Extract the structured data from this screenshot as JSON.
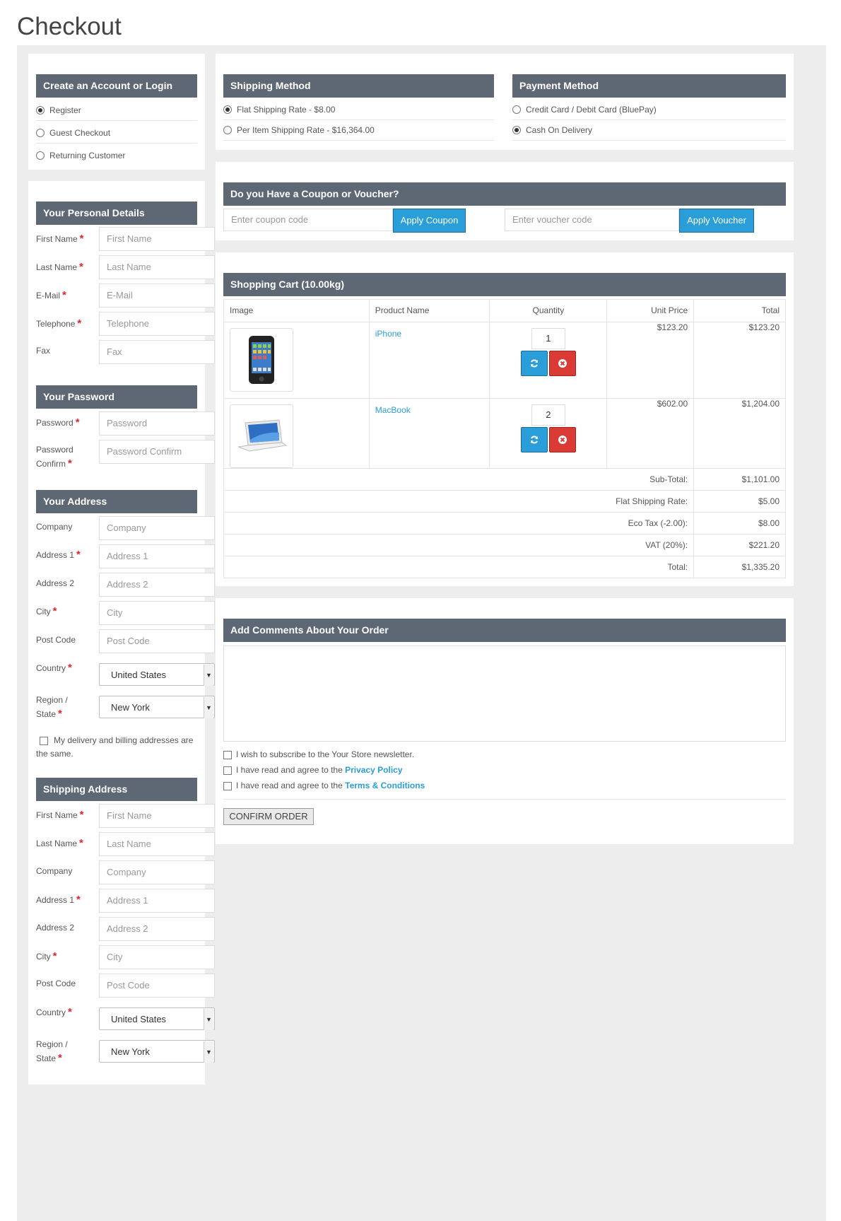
{
  "page": {
    "title": "Checkout"
  },
  "account": {
    "title": "Create an Account or Login",
    "options": [
      {
        "label": "Register",
        "checked": true
      },
      {
        "label": "Guest Checkout",
        "checked": false
      },
      {
        "label": "Returning Customer",
        "checked": false
      }
    ]
  },
  "personal": {
    "title": "Your Personal Details",
    "fields": [
      {
        "label": "First Name",
        "required": "*",
        "placeholder": "First Name"
      },
      {
        "label": "Last Name",
        "required": "*",
        "placeholder": "Last Name"
      },
      {
        "label": "E-Mail",
        "required": "*",
        "placeholder": "E-Mail"
      },
      {
        "label": "Telephone",
        "required": "*",
        "placeholder": "Telephone"
      },
      {
        "label": "Fax",
        "required": "",
        "placeholder": "Fax"
      }
    ]
  },
  "password": {
    "title": "Your Password",
    "password_label": "Password",
    "password_required": "*",
    "password_placeholder": "Password",
    "confirm_label_line1": "Password",
    "confirm_label_line2": "Confirm",
    "confirm_required": "*",
    "confirm_placeholder": "Password Confirm"
  },
  "address": {
    "title": "Your Address",
    "fields": [
      {
        "label": "Company",
        "required": "",
        "placeholder": "Company"
      },
      {
        "label": "Address 1",
        "required": "*",
        "placeholder": "Address 1"
      },
      {
        "label": "Address 2",
        "required": "",
        "placeholder": "Address 2"
      },
      {
        "label": "City",
        "required": "*",
        "placeholder": "City"
      },
      {
        "label": "Post Code",
        "required": "",
        "placeholder": "Post Code"
      }
    ],
    "country_label": "Country",
    "country_required": "*",
    "country_value": "United States",
    "region_label_line1": "Region /",
    "region_label_line2": "State",
    "region_required": "*",
    "region_value": "New York",
    "same_address_text_line1": "My delivery and billing addresses are",
    "same_address_text_line2": "the same."
  },
  "shipping_address": {
    "title": "Shipping Address",
    "fields": [
      {
        "label": "First Name",
        "required": "*",
        "placeholder": "First Name"
      },
      {
        "label": "Last Name",
        "required": "*",
        "placeholder": "Last Name"
      },
      {
        "label": "Company",
        "required": "",
        "placeholder": "Company"
      },
      {
        "label": "Address 1",
        "required": "*",
        "placeholder": "Address 1"
      },
      {
        "label": "Address 2",
        "required": "",
        "placeholder": "Address 2"
      },
      {
        "label": "City",
        "required": "*",
        "placeholder": "City"
      },
      {
        "label": "Post Code",
        "required": "",
        "placeholder": "Post Code"
      }
    ],
    "country_label": "Country",
    "country_required": "*",
    "country_value": "United States",
    "region_label_line1": "Region /",
    "region_label_line2": "State",
    "region_required": "*",
    "region_value": "New York"
  },
  "shipping_method": {
    "title": "Shipping Method",
    "options": [
      {
        "label": "Flat Shipping Rate - $8.00",
        "checked": true
      },
      {
        "label": "Per Item Shipping Rate - $16,364.00",
        "checked": false
      }
    ]
  },
  "payment_method": {
    "title": "Payment Method",
    "options": [
      {
        "label": "Credit Card / Debit Card (BluePay)",
        "checked": false
      },
      {
        "label": "Cash On Delivery",
        "checked": true
      }
    ]
  },
  "coupon": {
    "title": "Do you Have a Coupon or Voucher?",
    "coupon_placeholder": "Enter coupon code",
    "coupon_button": "Apply Coupon",
    "voucher_placeholder": "Enter voucher code",
    "voucher_button": "Apply Voucher"
  },
  "cart": {
    "title": "Shopping Cart (10.00kg)",
    "columns": [
      "Image",
      "Product Name",
      "Quantity",
      "Unit Price",
      "Total"
    ],
    "items": [
      {
        "name": "iPhone",
        "quantity": "1",
        "unit_price": "$123.20",
        "total": "$123.20",
        "image_icon": "iphone-image"
      },
      {
        "name": "MacBook",
        "quantity": "2",
        "unit_price": "$602.00",
        "total": "$1,204.00",
        "image_icon": "macbook-image"
      }
    ],
    "totals": [
      {
        "label": "Sub-Total:",
        "value": "$1,101.00"
      },
      {
        "label": "Flat Shipping Rate:",
        "value": "$5.00"
      },
      {
        "label": "Eco Tax (-2.00):",
        "value": "$8.00"
      },
      {
        "label": "VAT (20%):",
        "value": "$221.20"
      },
      {
        "label": "Total:",
        "value": "$1,335.20"
      }
    ]
  },
  "comments": {
    "title": "Add Comments About Your Order",
    "value": ""
  },
  "agreements": {
    "newsletter": "I wish to subscribe to the Your Store newsletter.",
    "privacy_prefix": "I have read and agree to the ",
    "privacy_link": "Privacy Policy",
    "terms_prefix": "I have read and agree to the ",
    "terms_link": "Terms & Conditions"
  },
  "confirm_button": "CONFIRM ORDER",
  "colors": {
    "header_bg": "#5d6874",
    "accent": "#2a9ed9",
    "danger": "#da3b34",
    "required": "#e2252c",
    "outer_bg": "#ededed"
  }
}
